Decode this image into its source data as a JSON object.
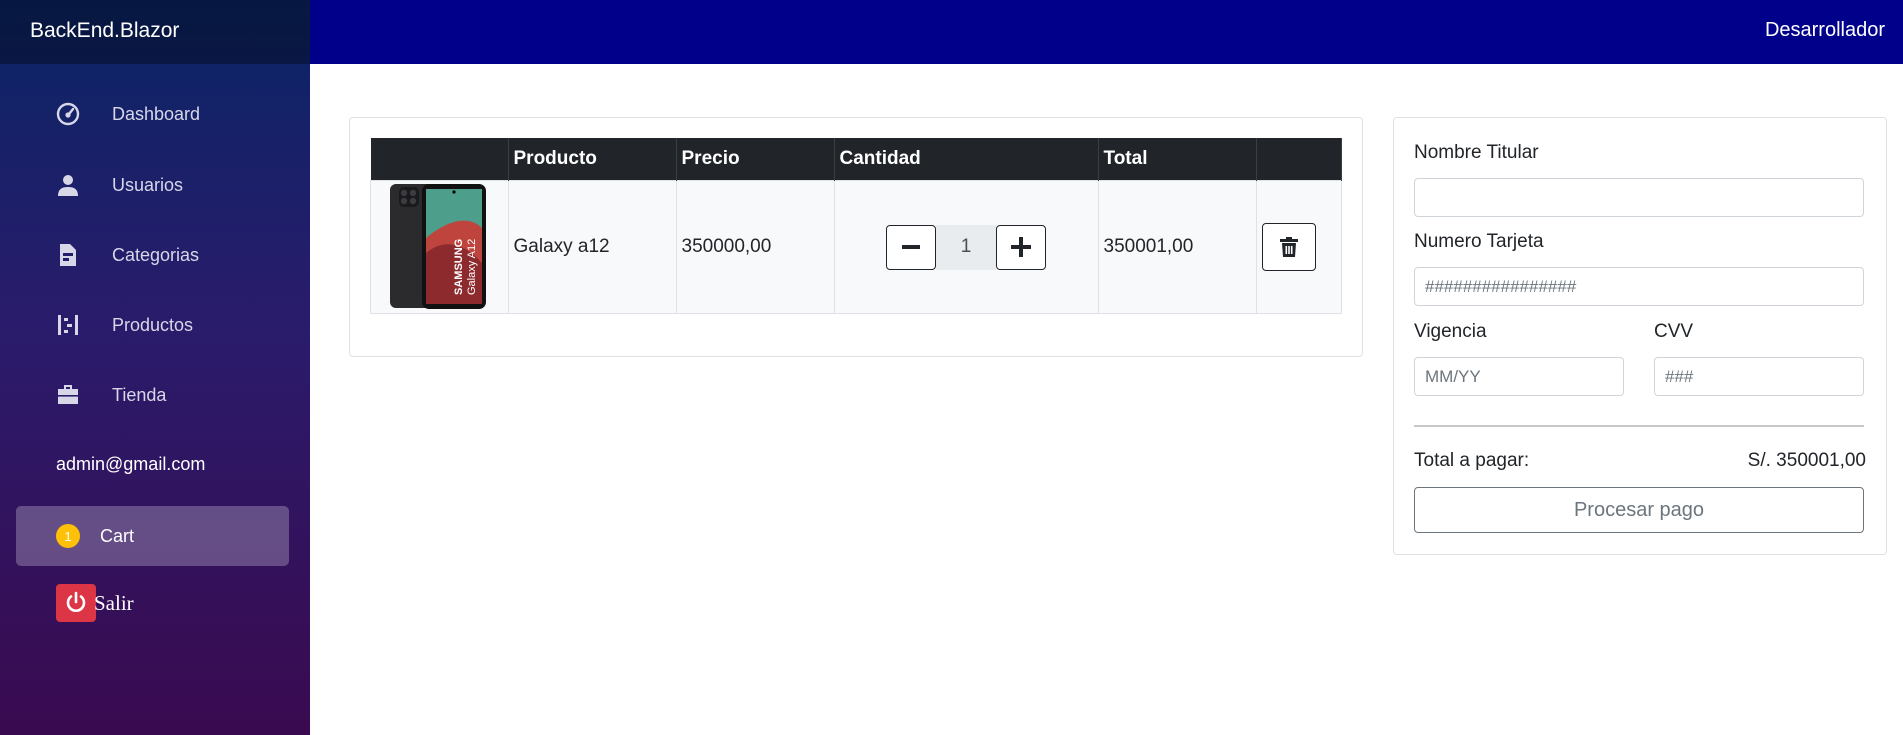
{
  "app": {
    "brand": "BackEnd.Blazor",
    "top_right_label": "Desarrollador"
  },
  "sidebar": {
    "items": [
      {
        "label": "Dashboard",
        "icon": "dashboard-icon"
      },
      {
        "label": "Usuarios",
        "icon": "user-icon"
      },
      {
        "label": "Categorias",
        "icon": "document-icon"
      },
      {
        "label": "Productos",
        "icon": "list-icon"
      },
      {
        "label": "Tienda",
        "icon": "briefcase-icon"
      }
    ],
    "user_email": "admin@gmail.com",
    "cart": {
      "label": "Cart",
      "badge": "1"
    },
    "logout_label": "Salir"
  },
  "cart_table": {
    "headers": [
      "",
      "Producto",
      "Precio",
      "Cantidad",
      "Total",
      ""
    ],
    "rows": [
      {
        "image_brand": "SAMSUNG",
        "image_model": "Galaxy A12",
        "product": "Galaxy a12",
        "price": "350000,00",
        "quantity": "1",
        "total": "350001,00"
      }
    ]
  },
  "payment": {
    "holder_label": "Nombre Titular",
    "holder_value": "",
    "card_label": "Numero Tarjeta",
    "card_placeholder": "################",
    "expiry_label": "Vigencia",
    "expiry_placeholder": "MM/YY",
    "cvv_label": "CVV",
    "cvv_placeholder": "###",
    "total_label": "Total a pagar:",
    "total_value": "S/. 350001,00",
    "pay_button": "Procesar pago"
  },
  "colors": {
    "topbar": "#00008b",
    "sidebar_top": "#0a2566",
    "sidebar_bottom": "#3a0a50",
    "badge": "#ffc107",
    "logout": "#dc3545",
    "table_header": "#212529"
  }
}
